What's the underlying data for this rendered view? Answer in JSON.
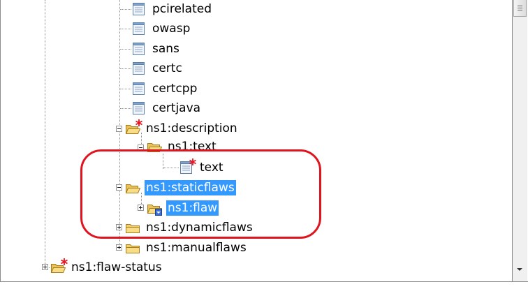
{
  "tree": {
    "nodes": [
      {
        "label": "pcirelated",
        "icon": "document-icon"
      },
      {
        "label": "owasp",
        "icon": "document-icon"
      },
      {
        "label": "sans",
        "icon": "document-icon"
      },
      {
        "label": "certc",
        "icon": "document-icon"
      },
      {
        "label": "certcpp",
        "icon": "document-icon"
      },
      {
        "label": "certjava",
        "icon": "document-icon"
      },
      {
        "label": "ns1:description",
        "icon": "open-folder-required-icon",
        "state": "expanded"
      },
      {
        "label": "ns1:text",
        "icon": "open-folder-icon",
        "state": "expanded"
      },
      {
        "label": "text",
        "icon": "document-required-icon"
      },
      {
        "label": "ns1:staticflaws",
        "icon": "open-folder-icon",
        "state": "expanded",
        "selected": true
      },
      {
        "label": "ns1:flaw",
        "icon": "open-folder-overlay-icon",
        "state": "collapsed",
        "selected": true
      },
      {
        "label": "ns1:dynamicflaws",
        "icon": "folder-icon",
        "state": "collapsed"
      },
      {
        "label": "ns1:manualflaws",
        "icon": "folder-icon",
        "state": "collapsed"
      },
      {
        "label": "ns1:flaw-status",
        "icon": "open-folder-required-icon",
        "state": "collapsed"
      }
    ]
  },
  "colors": {
    "selection": "#3399ff",
    "highlight_annotation": "#e0141e",
    "required_marker": "#e8141e"
  }
}
